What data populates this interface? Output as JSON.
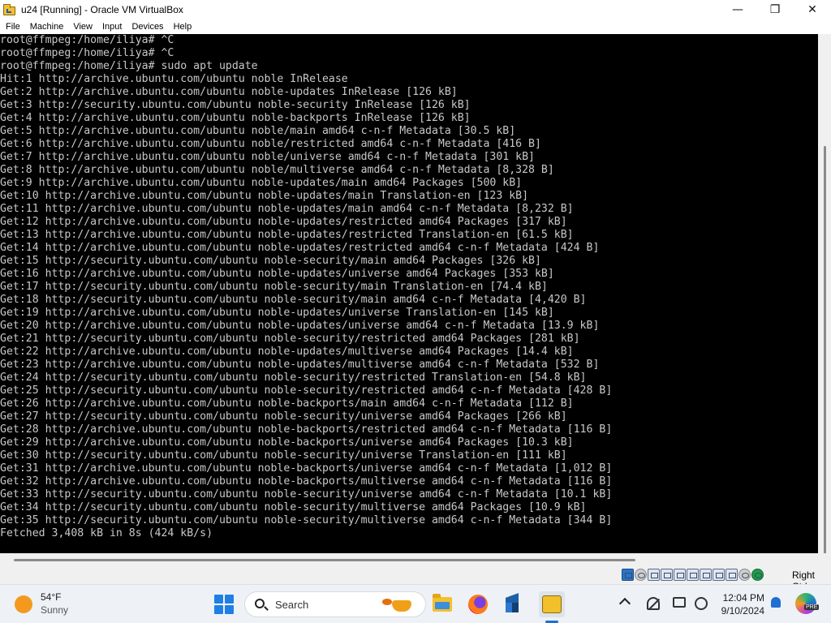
{
  "window": {
    "title": "u24 [Running] - Oracle VM VirtualBox",
    "controls": {
      "minimize": "—",
      "maximize": "❐",
      "close": "✕"
    }
  },
  "menu": [
    "File",
    "Machine",
    "View",
    "Input",
    "Devices",
    "Help"
  ],
  "terminal": {
    "lines": [
      "root@ffmpeg:/home/iliya# ^C",
      "root@ffmpeg:/home/iliya# ^C",
      "root@ffmpeg:/home/iliya# sudo apt update",
      "Hit:1 http://archive.ubuntu.com/ubuntu noble InRelease",
      "Get:2 http://archive.ubuntu.com/ubuntu noble-updates InRelease [126 kB]",
      "Get:3 http://security.ubuntu.com/ubuntu noble-security InRelease [126 kB]",
      "Get:4 http://archive.ubuntu.com/ubuntu noble-backports InRelease [126 kB]",
      "Get:5 http://archive.ubuntu.com/ubuntu noble/main amd64 c-n-f Metadata [30.5 kB]",
      "Get:6 http://archive.ubuntu.com/ubuntu noble/restricted amd64 c-n-f Metadata [416 B]",
      "Get:7 http://archive.ubuntu.com/ubuntu noble/universe amd64 c-n-f Metadata [301 kB]",
      "Get:8 http://archive.ubuntu.com/ubuntu noble/multiverse amd64 c-n-f Metadata [8,328 B]",
      "Get:9 http://archive.ubuntu.com/ubuntu noble-updates/main amd64 Packages [500 kB]",
      "Get:10 http://archive.ubuntu.com/ubuntu noble-updates/main Translation-en [123 kB]",
      "Get:11 http://archive.ubuntu.com/ubuntu noble-updates/main amd64 c-n-f Metadata [8,232 B]",
      "Get:12 http://archive.ubuntu.com/ubuntu noble-updates/restricted amd64 Packages [317 kB]",
      "Get:13 http://archive.ubuntu.com/ubuntu noble-updates/restricted Translation-en [61.5 kB]",
      "Get:14 http://archive.ubuntu.com/ubuntu noble-updates/restricted amd64 c-n-f Metadata [424 B]",
      "Get:15 http://security.ubuntu.com/ubuntu noble-security/main amd64 Packages [326 kB]",
      "Get:16 http://archive.ubuntu.com/ubuntu noble-updates/universe amd64 Packages [353 kB]",
      "Get:17 http://security.ubuntu.com/ubuntu noble-security/main Translation-en [74.4 kB]",
      "Get:18 http://security.ubuntu.com/ubuntu noble-security/main amd64 c-n-f Metadata [4,420 B]",
      "Get:19 http://archive.ubuntu.com/ubuntu noble-updates/universe Translation-en [145 kB]",
      "Get:20 http://archive.ubuntu.com/ubuntu noble-updates/universe amd64 c-n-f Metadata [13.9 kB]",
      "Get:21 http://security.ubuntu.com/ubuntu noble-security/restricted amd64 Packages [281 kB]",
      "Get:22 http://archive.ubuntu.com/ubuntu noble-updates/multiverse amd64 Packages [14.4 kB]",
      "Get:23 http://archive.ubuntu.com/ubuntu noble-updates/multiverse amd64 c-n-f Metadata [532 B]",
      "Get:24 http://security.ubuntu.com/ubuntu noble-security/restricted Translation-en [54.8 kB]",
      "Get:25 http://security.ubuntu.com/ubuntu noble-security/restricted amd64 c-n-f Metadata [428 B]",
      "Get:26 http://archive.ubuntu.com/ubuntu noble-backports/main amd64 c-n-f Metadata [112 B]",
      "Get:27 http://security.ubuntu.com/ubuntu noble-security/universe amd64 Packages [266 kB]",
      "Get:28 http://archive.ubuntu.com/ubuntu noble-backports/restricted amd64 c-n-f Metadata [116 B]",
      "Get:29 http://archive.ubuntu.com/ubuntu noble-backports/universe amd64 Packages [10.3 kB]",
      "Get:30 http://security.ubuntu.com/ubuntu noble-security/universe Translation-en [111 kB]",
      "Get:31 http://archive.ubuntu.com/ubuntu noble-backports/universe amd64 c-n-f Metadata [1,012 B]",
      "Get:32 http://archive.ubuntu.com/ubuntu noble-backports/multiverse amd64 c-n-f Metadata [116 B]",
      "Get:33 http://security.ubuntu.com/ubuntu noble-security/universe amd64 c-n-f Metadata [10.1 kB]",
      "Get:34 http://security.ubuntu.com/ubuntu noble-security/multiverse amd64 Packages [10.9 kB]",
      "Get:35 http://security.ubuntu.com/ubuntu noble-security/multiverse amd64 c-n-f Metadata [344 B]",
      "Fetched 3,408 kB in 8s (424 kB/s)"
    ]
  },
  "statusbar": {
    "icons": [
      "hard-disk-icon",
      "optical-drive-icon",
      "audio-icon",
      "network-icon",
      "usb-icon",
      "shared-folders-icon",
      "display-icon",
      "video-capture-icon",
      "cpu-activity-icon",
      "mouse-integration-icon",
      "keyboard-capture-icon"
    ],
    "host_key": "Right Ctrl"
  },
  "taskbar": {
    "weather": {
      "temp": "54°F",
      "condition": "Sunny"
    },
    "search_placeholder": "Search",
    "apps": [
      "file-explorer-icon",
      "firefox-icon",
      "virtualbox-manager-icon",
      "virtualbox-vm-icon"
    ],
    "clock": {
      "time": "12:04 PM",
      "date": "9/10/2024"
    },
    "copilot_badge": "PRE"
  }
}
